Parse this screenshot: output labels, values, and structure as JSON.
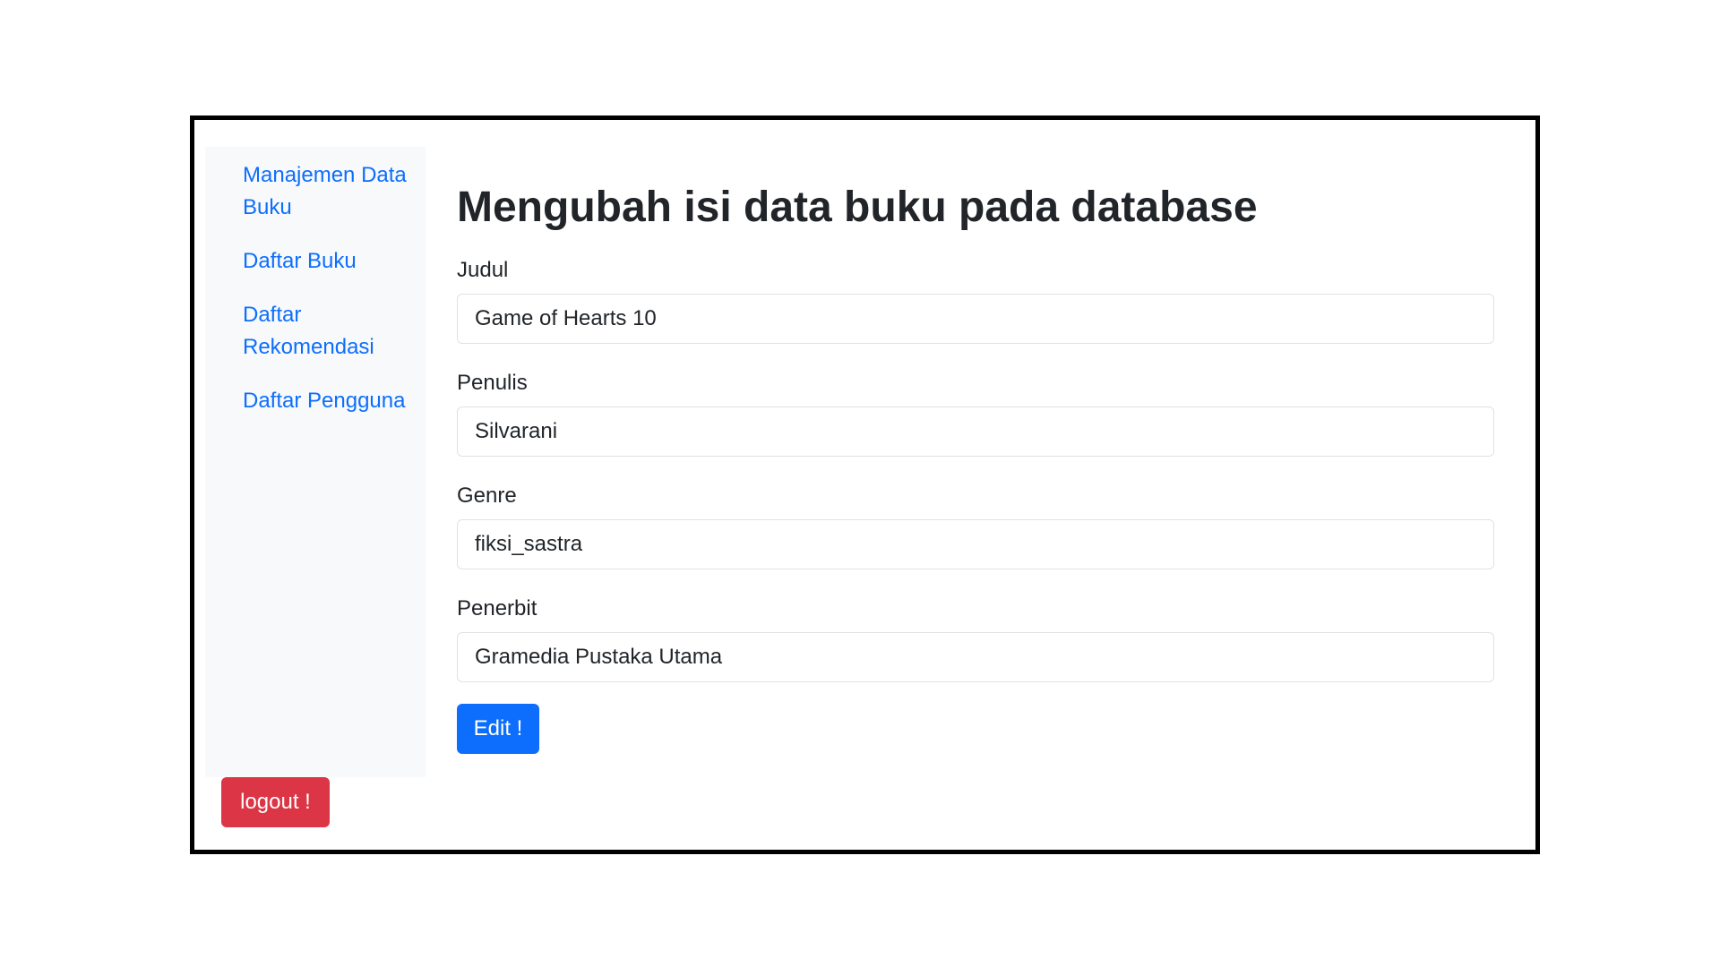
{
  "sidebar": {
    "items": [
      {
        "label": "Manajemen Data Buku"
      },
      {
        "label": "Daftar Buku"
      },
      {
        "label": "Daftar Rekomendasi"
      },
      {
        "label": "Daftar Pengguna"
      }
    ],
    "logout_label": "logout !"
  },
  "main": {
    "title": "Mengubah isi data buku pada database",
    "fields": [
      {
        "label": "Judul",
        "value": "Game of Hearts 10"
      },
      {
        "label": "Penulis",
        "value": "Silvarani"
      },
      {
        "label": "Genre",
        "value": "fiksi_sastra"
      },
      {
        "label": "Penerbit",
        "value": "Gramedia Pustaka Utama"
      }
    ],
    "submit_label": "Edit !"
  },
  "colors": {
    "primary": "#0d6efd",
    "danger": "#dc3545",
    "sidebar_bg": "#f8f9fa",
    "text": "#212529",
    "frame_border": "#000000"
  }
}
